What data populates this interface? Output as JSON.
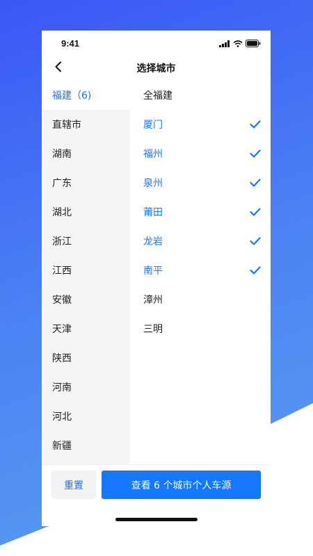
{
  "status_bar": {
    "time": "9:41"
  },
  "nav": {
    "title": "选择城市"
  },
  "provinces": [
    {
      "label": "福建（6)",
      "selected": true
    },
    {
      "label": "直辖市",
      "selected": false
    },
    {
      "label": "湖南",
      "selected": false
    },
    {
      "label": "广东",
      "selected": false
    },
    {
      "label": "湖北",
      "selected": false
    },
    {
      "label": "浙江",
      "selected": false
    },
    {
      "label": "江西",
      "selected": false
    },
    {
      "label": "安徽",
      "selected": false
    },
    {
      "label": "天津",
      "selected": false
    },
    {
      "label": "陕西",
      "selected": false
    },
    {
      "label": "河南",
      "selected": false
    },
    {
      "label": "河北",
      "selected": false
    },
    {
      "label": "新疆",
      "selected": false
    }
  ],
  "cities": [
    {
      "label": "全福建",
      "selected": false
    },
    {
      "label": "厦门",
      "selected": true
    },
    {
      "label": "福州",
      "selected": true
    },
    {
      "label": "泉州",
      "selected": true
    },
    {
      "label": "莆田",
      "selected": true
    },
    {
      "label": "龙岩",
      "selected": true
    },
    {
      "label": "南平",
      "selected": true
    },
    {
      "label": "漳州",
      "selected": false
    },
    {
      "label": "三明",
      "selected": false
    }
  ],
  "footer": {
    "reset_label": "重置",
    "confirm_label": "查看 6 个城市个人车源"
  },
  "colors": {
    "accent": "#1677ff",
    "sidebar_bg": "#f5f5f7",
    "background_gradient_start": "#3a57f5",
    "background_gradient_end": "#5aa0f0"
  },
  "icons": {
    "back": "chevron-left-icon",
    "check": "check-icon",
    "signal": "cellular-signal-icon",
    "wifi": "wifi-icon",
    "battery": "battery-icon"
  }
}
